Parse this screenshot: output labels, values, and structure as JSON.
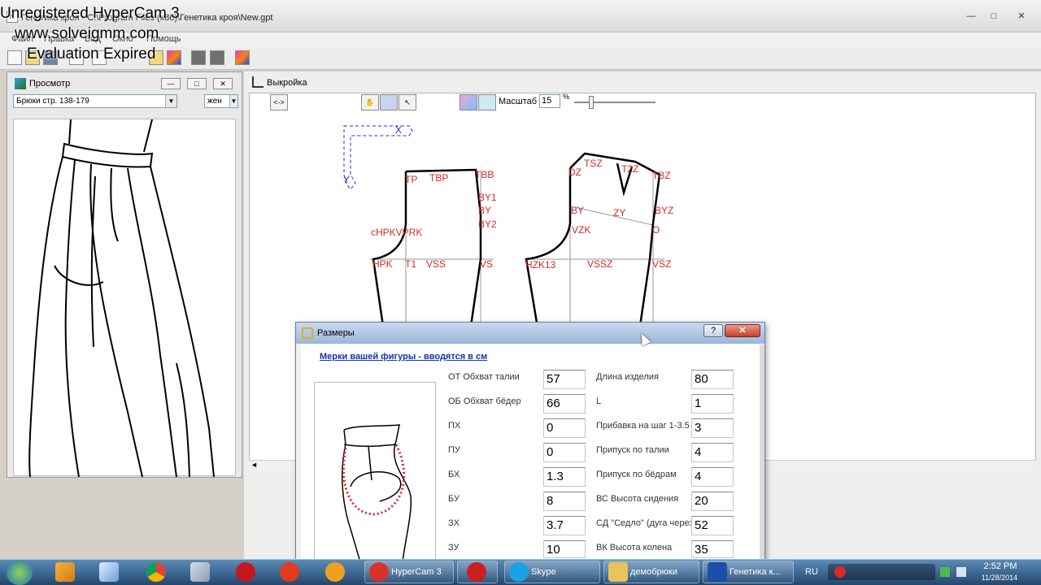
{
  "app": {
    "title": "Генетика кроя - C:\\Program Files (x86)\\Генетика кроя\\New.gpt",
    "window_buttons": [
      "—",
      "□",
      "✕"
    ],
    "menu": [
      "Файл",
      "Правка",
      "Вид",
      "Окно",
      "Помощь"
    ]
  },
  "watermark": {
    "line1": "Unregistered HyperCam 3",
    "line2": "www.solveigmm.com",
    "line3": "Evaluation Expired"
  },
  "preview": {
    "title": "Просмотр",
    "model_select": "Брюки стр. 138-179",
    "gender_select": "жен"
  },
  "pattern": {
    "title": "Выкройка",
    "nav_button": "<->",
    "scale_label": "Масштаб",
    "scale_value": "15",
    "scale_unit": "%",
    "labels": {
      "x": "X",
      "y": "Y",
      "tp": "TP",
      "tbp": "TBP",
      "tbb": "TBB",
      "by1": "BY1",
      "by": "BY",
      "by2": "BY2",
      "chpk": "cHPKVPRK",
      "hpk": "HPK",
      "t1": "T1",
      "vss": "VSS",
      "vs": "VS",
      "dz": "DZ",
      "tsz": "TSZ",
      "t2z": "T2Z",
      "tbz": "TBZ",
      "by_left": "BY",
      "zy": "ZY",
      "byz": "BYZ",
      "vzk": "VZK",
      "o": "O",
      "hzk": "HZK13",
      "vssz": "VSSZ",
      "vsz": "VSZ"
    }
  },
  "dialog": {
    "title": "Размеры",
    "help": "?",
    "close": "✕",
    "subtitle": "Мерки вашей фигуры - вводятся в см",
    "left_fields": [
      {
        "label": "ОТ Обхват талии",
        "value": "57"
      },
      {
        "label": "ОБ Обхват бёдер",
        "value": "66"
      },
      {
        "label": "ПХ",
        "value": "0"
      },
      {
        "label": "ПУ",
        "value": "0"
      },
      {
        "label": "БХ",
        "value": "1.3"
      },
      {
        "label": "БУ",
        "value": "8"
      },
      {
        "label": "ЗХ",
        "value": "3.7"
      },
      {
        "label": "ЗУ",
        "value": "10"
      }
    ],
    "right_fields": [
      {
        "label": "Длина изделия",
        "value": "80"
      },
      {
        "label": "L",
        "value": "1"
      },
      {
        "label": "Прибавка на шаг 1-3.5",
        "value": "3"
      },
      {
        "label": "Припуск по талии",
        "value": "4"
      },
      {
        "label": "Припуск по бёдрам",
        "value": "4"
      },
      {
        "label": "ВС Высота сидения",
        "value": "20"
      },
      {
        "label": "СД \"Седло\" (дуга через",
        "value": "52"
      },
      {
        "label": "ВК Высота колена",
        "value": "35"
      }
    ]
  },
  "taskbar": {
    "buttons": [
      {
        "label": "HyperCam 3",
        "color": "#d8332a"
      },
      {
        "label": "",
        "color": "#cc1f1f"
      },
      {
        "label": "Skype",
        "color": "#19a3e6"
      },
      {
        "label": "демобрюки",
        "color": "#e8c45a"
      },
      {
        "label": "Генетика к...",
        "color": "#1c4fa8"
      }
    ],
    "quick_icons": [
      "windows-start-icon",
      "media-player-icon",
      "mail-icon",
      "chrome-icon",
      "audio-icon",
      "yandex-icon",
      "at-icon",
      "opera-icon"
    ],
    "lang": "RU",
    "time": "2:52 PM",
    "date": "11/28/2014"
  }
}
